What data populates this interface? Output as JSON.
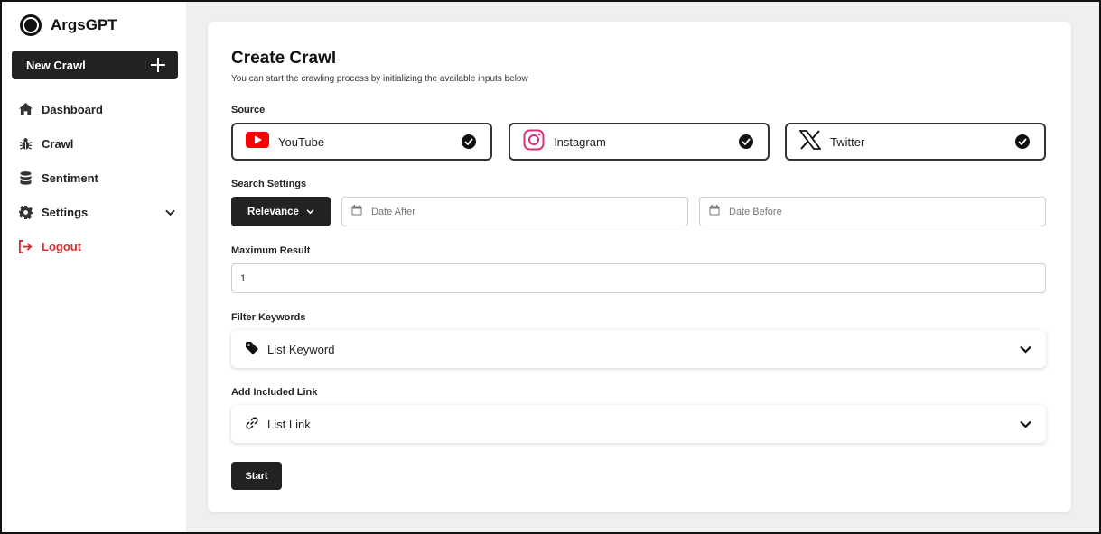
{
  "app": {
    "name": "ArgsGPT"
  },
  "sidebar": {
    "new_button": "New Crawl",
    "items": [
      {
        "label": "Dashboard",
        "icon": "home-icon"
      },
      {
        "label": "Crawl",
        "icon": "bug-icon"
      },
      {
        "label": "Sentiment",
        "icon": "database-icon"
      },
      {
        "label": "Settings",
        "icon": "gear-icon"
      },
      {
        "label": "Logout",
        "icon": "logout-icon"
      }
    ]
  },
  "page": {
    "title": "Create Crawl",
    "subtitle": "You can start the crawling process by initializing the available inputs below"
  },
  "source": {
    "label": "Source",
    "options": [
      {
        "name": "YouTube",
        "icon": "youtube-icon",
        "checked": true
      },
      {
        "name": "Instagram",
        "icon": "instagram-icon",
        "checked": true
      },
      {
        "name": "Twitter",
        "icon": "x-twitter-icon",
        "checked": true
      }
    ]
  },
  "search_settings": {
    "label": "Search Settings",
    "sort_selected": "Relevance",
    "date_after_placeholder": "Date After",
    "date_before_placeholder": "Date Before"
  },
  "maximum_result": {
    "label": "Maximum Result",
    "value": "1"
  },
  "filter_keywords": {
    "label": "Filter Keywords",
    "title": "List Keyword"
  },
  "included_link": {
    "label": "Add Included Link",
    "title": "List Link"
  },
  "actions": {
    "start": "Start"
  },
  "colors": {
    "dark": "#222222",
    "logout_red": "#d32f2f",
    "youtube_red": "#ff0000",
    "instagram_pink": "#d6307f",
    "background": "#efefef"
  }
}
